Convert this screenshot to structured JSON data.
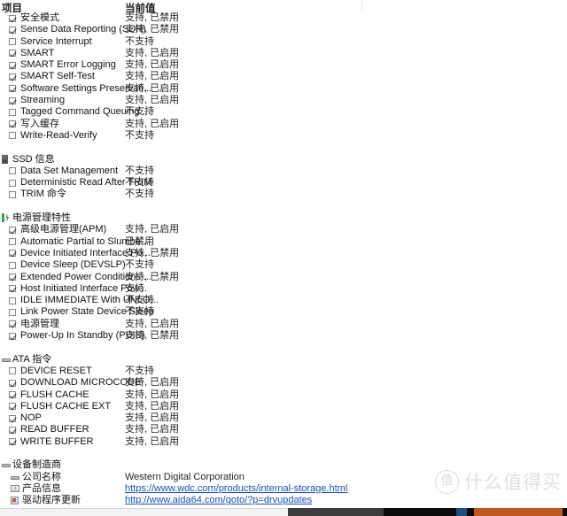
{
  "header": {
    "col_item": "项目",
    "col_value": "当前值"
  },
  "sections": [
    {
      "id": "features",
      "header": null,
      "rows": [
        {
          "type": "item",
          "checked": true,
          "label": "安全模式",
          "value": "支持, 已禁用"
        },
        {
          "type": "item",
          "checked": true,
          "label": "Sense Data Reporting (SDR)",
          "value": "支持, 已禁用"
        },
        {
          "type": "item",
          "checked": false,
          "label": "Service Interrupt",
          "value": "不支持"
        },
        {
          "type": "item",
          "checked": true,
          "label": "SMART",
          "value": "支持, 已启用"
        },
        {
          "type": "item",
          "checked": true,
          "label": "SMART Error Logging",
          "value": "支持, 已启用"
        },
        {
          "type": "item",
          "checked": true,
          "label": "SMART Self-Test",
          "value": "支持, 已启用"
        },
        {
          "type": "item",
          "checked": true,
          "label": "Software Settings Preservati...",
          "value": "支持, 已启用"
        },
        {
          "type": "item",
          "checked": true,
          "label": "Streaming",
          "value": "支持, 已启用"
        },
        {
          "type": "item",
          "checked": false,
          "label": "Tagged Command Queuing ...",
          "value": "不支持"
        },
        {
          "type": "item",
          "checked": true,
          "label": "写入缓存",
          "value": "支持, 已启用"
        },
        {
          "type": "item",
          "checked": false,
          "label": "Write-Read-Verify",
          "value": "不支持"
        }
      ]
    },
    {
      "id": "ssd",
      "header": {
        "icon": "ssd-icon",
        "label": "SSD 信息"
      },
      "rows": [
        {
          "type": "item",
          "checked": false,
          "label": "Data Set Management",
          "value": "不支持"
        },
        {
          "type": "item",
          "checked": false,
          "label": "Deterministic Read After TRIM",
          "value": "不支持"
        },
        {
          "type": "item",
          "checked": false,
          "label": "TRIM 命令",
          "value": "不支持"
        }
      ]
    },
    {
      "id": "power",
      "header": {
        "icon": "power-icon",
        "label": "电源管理特性"
      },
      "rows": [
        {
          "type": "item",
          "checked": true,
          "label": "高级电源管理(APM)",
          "value": "支持, 已启用"
        },
        {
          "type": "item",
          "checked": false,
          "label": "Automatic Partial to Slumbe...",
          "value": "已禁用"
        },
        {
          "type": "item",
          "checked": true,
          "label": "Device Initiated Interface Po...",
          "value": "支持, 已禁用"
        },
        {
          "type": "item",
          "checked": false,
          "label": "Device Sleep (DEVSLP)",
          "value": "不支持"
        },
        {
          "type": "item",
          "checked": true,
          "label": "Extended Power Conditions ...",
          "value": "支持, 已禁用"
        },
        {
          "type": "item",
          "checked": true,
          "label": "Host Initiated Interface Pow...",
          "value": "支持"
        },
        {
          "type": "item",
          "checked": false,
          "label": "IDLE IMMEDIATE With UNLO...",
          "value": "不支持"
        },
        {
          "type": "item",
          "checked": false,
          "label": "Link Power State Device Sleep",
          "value": "不支持"
        },
        {
          "type": "item",
          "checked": true,
          "label": "电源管理",
          "value": "支持, 已启用"
        },
        {
          "type": "item",
          "checked": true,
          "label": "Power-Up In Standby (PUIS)",
          "value": "支持, 已禁用"
        }
      ]
    },
    {
      "id": "ata",
      "header": {
        "icon": "drive-icon",
        "label": "ATA 指令"
      },
      "rows": [
        {
          "type": "item",
          "checked": false,
          "label": "DEVICE RESET",
          "value": "不支持"
        },
        {
          "type": "item",
          "checked": true,
          "label": "DOWNLOAD MICROCODE",
          "value": "支持, 已启用"
        },
        {
          "type": "item",
          "checked": true,
          "label": "FLUSH CACHE",
          "value": "支持, 已启用"
        },
        {
          "type": "item",
          "checked": true,
          "label": "FLUSH CACHE EXT",
          "value": "支持, 已启用"
        },
        {
          "type": "item",
          "checked": true,
          "label": "NOP",
          "value": "支持, 已启用"
        },
        {
          "type": "item",
          "checked": true,
          "label": "READ BUFFER",
          "value": "支持, 已启用"
        },
        {
          "type": "item",
          "checked": true,
          "label": "WRITE BUFFER",
          "value": "支持, 已启用"
        }
      ]
    },
    {
      "id": "vendor",
      "header": {
        "icon": "drive-icon",
        "label": "设备制造商"
      },
      "rows": [
        {
          "type": "sub",
          "icon": "company-icon",
          "label": "公司名称",
          "value": "Western Digital Corporation",
          "link": false
        },
        {
          "type": "sub",
          "icon": "product-icon",
          "label": "产品信息",
          "value": "https://www.wdc.com/products/internal-storage.html",
          "link": true
        },
        {
          "type": "sub",
          "icon": "driver-icon",
          "label": "驱动程序更新",
          "value": "http://www.aida64.com/goto/?p=drvupdates",
          "link": true
        }
      ]
    }
  ],
  "watermark": {
    "badge": "值",
    "text": "什么值得买"
  },
  "colors": {
    "link": "#1a4fb4",
    "accent_green": "#2fa84f",
    "taskbar_orange": "#c1581f"
  }
}
